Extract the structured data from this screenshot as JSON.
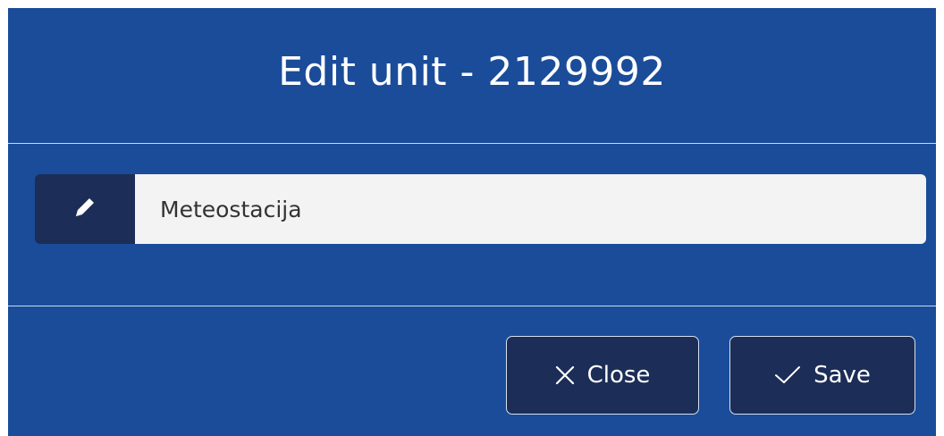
{
  "modal": {
    "title": "Edit unit - 2129992"
  },
  "form": {
    "name_value": "Meteostacija",
    "addon_icon": "pencil-icon"
  },
  "footer": {
    "close_label": "Close",
    "close_icon": "x-icon",
    "save_label": "Save",
    "save_icon": "check-icon"
  },
  "colors": {
    "modal_bg": "#1a4c9a",
    "dark_accent": "#1c2d57",
    "input_bg": "#f3f3f3",
    "text_light": "#ffffff"
  }
}
